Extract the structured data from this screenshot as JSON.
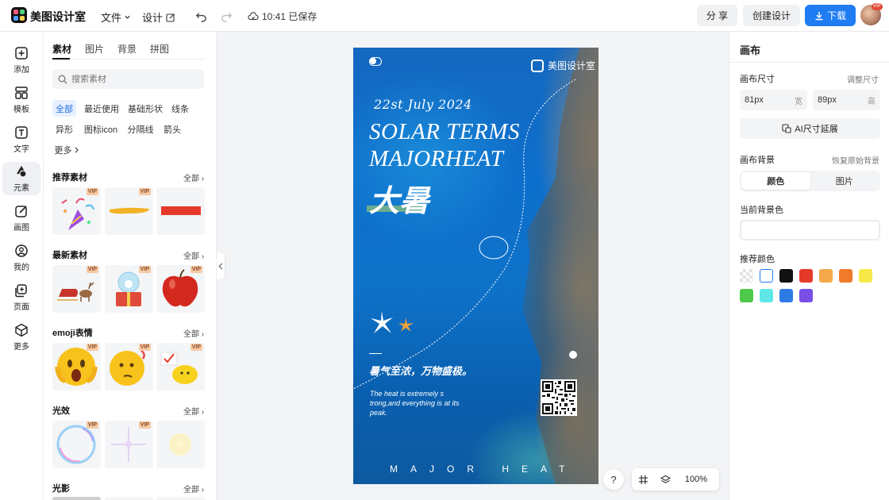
{
  "topbar": {
    "app_name": "美图设计室",
    "menu_file": "文件",
    "menu_design": "设计",
    "save_status": "10:41 已保存",
    "share_label": "分 享",
    "create_label": "创建设计",
    "download_label": "下载",
    "avatar_badge": "VIP"
  },
  "rail": [
    {
      "label": "添加",
      "icon": "plus-square-icon"
    },
    {
      "label": "模板",
      "icon": "template-icon"
    },
    {
      "label": "文字",
      "icon": "text-icon"
    },
    {
      "label": "元素",
      "icon": "shapes-icon"
    },
    {
      "label": "画图",
      "icon": "draw-icon"
    },
    {
      "label": "我的",
      "icon": "user-icon"
    },
    {
      "label": "页面",
      "icon": "page-icon"
    },
    {
      "label": "更多",
      "icon": "cube-icon"
    }
  ],
  "assets": {
    "tabs": [
      "素材",
      "图片",
      "背景",
      "拼图"
    ],
    "search_placeholder": "搜索素材",
    "chips": [
      "全部",
      "最近使用",
      "基础形状",
      "线条",
      "异形",
      "图标icon",
      "分隔线",
      "箭头",
      "更多"
    ],
    "all_label": "全部",
    "vip_label": "VIP",
    "sections": [
      "推荐素材",
      "最新素材",
      "emoji表情",
      "光效",
      "光影"
    ]
  },
  "poster": {
    "brand": "美图设计室",
    "date": "22st July 2024",
    "title_line1": "SOLAR TERMS",
    "title_line2": "MAJORHEAT",
    "title_cn": "大暑",
    "slogan": "暑气至浓，万物盛极。",
    "description": "The heat is extremely s trong,and everything is at its peak.",
    "footer": "MAJOR HEAT"
  },
  "zoom": {
    "help": "?",
    "level": "100%"
  },
  "props": {
    "heading": "画布",
    "size_label": "画布尺寸",
    "adjust_size": "调整尺寸",
    "width_value": "81px",
    "width_unit": "宽",
    "height_value": "89px",
    "height_unit": "高",
    "ai_button": "AI尺寸延展",
    "bg_label": "画布背景",
    "restore_bg": "恢复原始背景",
    "seg_color": "颜色",
    "seg_image": "图片",
    "current_bg": "当前背景色",
    "recommended": "推荐颜色",
    "swatches": [
      "transparent",
      "#ffffff",
      "#111111",
      "#e53a2a",
      "#f5a84a",
      "#ef7a2a",
      "#f7e94a",
      "#4fc94a",
      "#5fe6e6",
      "#2f7be6",
      "#7a4fe6"
    ]
  }
}
